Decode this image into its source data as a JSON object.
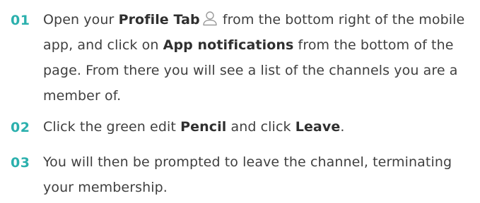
{
  "steps": [
    {
      "number": "01",
      "parts": {
        "t1": "Open your ",
        "b1": "Profile Tab",
        "t2": " from the bottom right of the mobile app, and click on ",
        "b2": "App notifications",
        "t3": " from the bottom of the page.  From there you will see a list of the channels you are a member of."
      },
      "icon": "user-profile-icon"
    },
    {
      "number": "02",
      "parts": {
        "t1": "Click the green edit ",
        "b1": "Pencil",
        "t2": " and click ",
        "b2": "Leave",
        "t3": "."
      }
    },
    {
      "number": "03",
      "parts": {
        "t1": "You will then be prompted to leave the channel, terminating your membership."
      }
    }
  ],
  "colors": {
    "step_number": "#2bb0ad",
    "body_text": "#3f3f3f",
    "icon_stroke": "#9a9a9a"
  }
}
